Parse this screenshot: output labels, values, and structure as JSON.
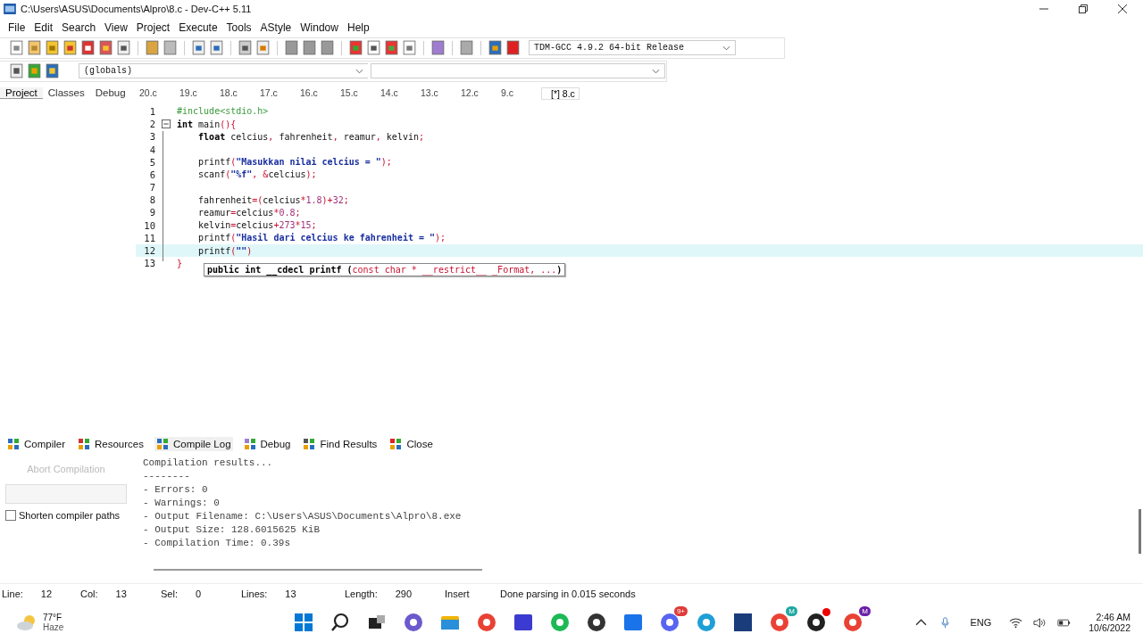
{
  "window": {
    "title": "C:\\Users\\ASUS\\Documents\\Alpro\\8.c - Dev-C++ 5.11"
  },
  "menu": [
    "File",
    "Edit",
    "Search",
    "View",
    "Project",
    "Execute",
    "Tools",
    "AStyle",
    "Window",
    "Help"
  ],
  "compiler_select": {
    "value": "TDM-GCC 4.9.2 64-bit Release"
  },
  "scope_select": {
    "value": "(globals)"
  },
  "left_tabs": [
    {
      "label": "Project",
      "selected": true
    },
    {
      "label": "Classes",
      "selected": false
    },
    {
      "label": "Debug",
      "selected": false
    }
  ],
  "file_tabs": [
    {
      "label": "20.c",
      "selected": false
    },
    {
      "label": "19.c",
      "selected": false
    },
    {
      "label": "18.c",
      "selected": false
    },
    {
      "label": "17.c",
      "selected": false
    },
    {
      "label": "16.c",
      "selected": false
    },
    {
      "label": "15.c",
      "selected": false
    },
    {
      "label": "14.c",
      "selected": false
    },
    {
      "label": "13.c",
      "selected": false
    },
    {
      "label": "12.c",
      "selected": false
    },
    {
      "label": "9.c",
      "selected": false
    },
    {
      "label": "[*] 8.c",
      "selected": true
    }
  ],
  "code": [
    {
      "number": "1",
      "highlighted": false,
      "tokens": [
        {
          "kind": "pre",
          "text": "#include<stdio.h>"
        }
      ]
    },
    {
      "number": "2",
      "highlighted": false,
      "tokens": [
        {
          "kind": "kw",
          "text": "int"
        },
        {
          "kind": "id",
          "text": " main"
        },
        {
          "kind": "sym",
          "text": "(){"
        }
      ]
    },
    {
      "number": "3",
      "highlighted": false,
      "tokens": [
        {
          "kind": "kw",
          "text": "    float"
        },
        {
          "kind": "id",
          "text": " celcius"
        },
        {
          "kind": "sym",
          "text": ", "
        },
        {
          "kind": "id",
          "text": "fahrenheit"
        },
        {
          "kind": "sym",
          "text": ", "
        },
        {
          "kind": "id",
          "text": "reamur"
        },
        {
          "kind": "sym",
          "text": ", "
        },
        {
          "kind": "id",
          "text": "kelvin"
        },
        {
          "kind": "sym",
          "text": ";"
        }
      ]
    },
    {
      "number": "4",
      "highlighted": false
    },
    {
      "number": "5",
      "highlighted": false,
      "tokens": [
        {
          "kind": "id",
          "text": "    printf"
        },
        {
          "kind": "sym",
          "text": "("
        },
        {
          "kind": "str",
          "text": "\"Masukkan nilai celcius = \""
        },
        {
          "kind": "sym",
          "text": ");"
        }
      ]
    },
    {
      "number": "6",
      "highlighted": false,
      "tokens": [
        {
          "kind": "id",
          "text": "    scanf"
        },
        {
          "kind": "sym",
          "text": "("
        },
        {
          "kind": "str",
          "text": "\"%f\""
        },
        {
          "kind": "sym",
          "text": ", &"
        },
        {
          "kind": "id",
          "text": "celcius"
        },
        {
          "kind": "sym",
          "text": ");"
        }
      ]
    },
    {
      "number": "7",
      "highlighted": false
    },
    {
      "number": "8",
      "highlighted": false,
      "tokens": [
        {
          "kind": "id",
          "text": "    fahrenheit"
        },
        {
          "kind": "sym",
          "text": "=("
        },
        {
          "kind": "id",
          "text": "celcius"
        },
        {
          "kind": "sym",
          "text": "*"
        },
        {
          "kind": "num",
          "text": "1.8"
        },
        {
          "kind": "sym",
          "text": ")+"
        },
        {
          "kind": "num",
          "text": "32"
        },
        {
          "kind": "sym",
          "text": ";"
        }
      ]
    },
    {
      "number": "9",
      "highlighted": false,
      "tokens": [
        {
          "kind": "id",
          "text": "    reamur"
        },
        {
          "kind": "sym",
          "text": "="
        },
        {
          "kind": "id",
          "text": "celcius"
        },
        {
          "kind": "sym",
          "text": "*"
        },
        {
          "kind": "num",
          "text": "0.8"
        },
        {
          "kind": "sym",
          "text": ";"
        }
      ]
    },
    {
      "number": "10",
      "highlighted": false,
      "tokens": [
        {
          "kind": "id",
          "text": "    kelvin"
        },
        {
          "kind": "sym",
          "text": "="
        },
        {
          "kind": "id",
          "text": "celcius"
        },
        {
          "kind": "sym",
          "text": "+"
        },
        {
          "kind": "num",
          "text": "273"
        },
        {
          "kind": "sym",
          "text": "*"
        },
        {
          "kind": "num",
          "text": "15"
        },
        {
          "kind": "sym",
          "text": ";"
        }
      ]
    },
    {
      "number": "11",
      "highlighted": false,
      "tokens": [
        {
          "kind": "id",
          "text": "    printf"
        },
        {
          "kind": "sym",
          "text": "("
        },
        {
          "kind": "str",
          "text": "\"Hasil dari celcius ke fahrenheit = \""
        },
        {
          "kind": "sym",
          "text": ");"
        }
      ]
    },
    {
      "number": "12",
      "highlighted": true,
      "tokens": [
        {
          "kind": "id",
          "text": "    printf"
        },
        {
          "kind": "sym",
          "text": "("
        },
        {
          "kind": "str",
          "text": "\"\""
        },
        {
          "kind": "sym",
          "text": ")"
        }
      ]
    },
    {
      "number": "13",
      "highlighted": false,
      "tokens": [
        {
          "kind": "sym",
          "text": "}"
        }
      ]
    }
  ],
  "tooltip": {
    "tokens": [
      {
        "kind": "kw",
        "text": "public int __cdecl printf ("
      },
      {
        "kind": "sym",
        "text": "const char * __restrict__ _Format, ..."
      },
      {
        "kind": "kw",
        "text": ")"
      }
    ]
  },
  "bottom_tabs": [
    {
      "label": "Compiler",
      "selected": false
    },
    {
      "label": "Resources",
      "selected": false
    },
    {
      "label": "Compile Log",
      "selected": true
    },
    {
      "label": "Debug",
      "selected": false
    },
    {
      "label": "Find Results",
      "selected": false
    },
    {
      "label": "Close",
      "selected": false
    }
  ],
  "abort_button": {
    "label": "Abort Compilation",
    "disabled": true
  },
  "progress": {
    "level": 0
  },
  "shorten_paths": {
    "label": "Shorten compiler paths",
    "checked": false
  },
  "log": [
    "Compilation results...",
    "--------",
    "- Errors: 0",
    "- Warnings: 0",
    "- Output Filename: C:\\Users\\ASUS\\Documents\\Alpro\\8.exe",
    "- Output Size: 128.6015625 KiB",
    "- Compilation Time: 0.39s"
  ],
  "status_bar": [
    {
      "label": "Line:",
      "value": "12"
    },
    {
      "label": "Col:",
      "value": "13"
    },
    {
      "label": "Sel:",
      "value": "0"
    },
    {
      "label": "Lines:",
      "value": "13"
    },
    {
      "label": "Length:",
      "value": "290"
    },
    {
      "value": "Insert"
    },
    {
      "value": "Done parsing in 0.015 seconds"
    }
  ],
  "taskbar": {
    "weather": {
      "temperature": "77°F",
      "condition": "Haze"
    },
    "badges": [
      "9+",
      "M",
      "M"
    ],
    "language": "ENG",
    "time": "2:46 AM",
    "date": "10/6/2022"
  }
}
